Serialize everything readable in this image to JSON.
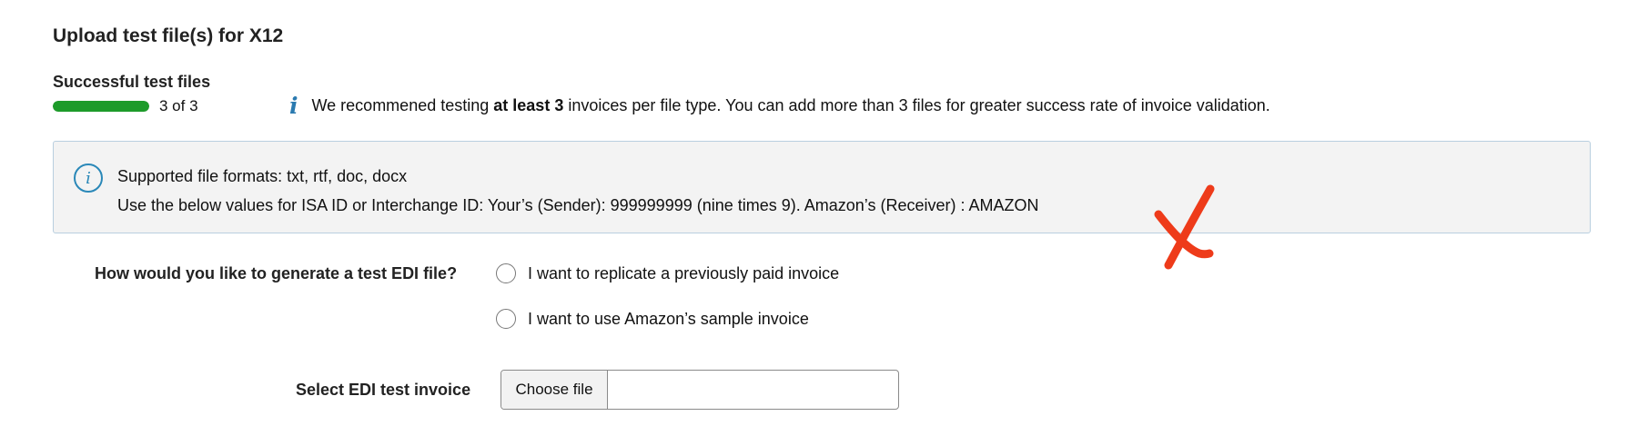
{
  "title": "Upload test file(s) for X12",
  "progress": {
    "label": "Successful test files",
    "count_text": "3 of 3",
    "completed": 3,
    "total": 3,
    "fill_fraction": 1.0,
    "color": "#1d9b2a"
  },
  "tip": {
    "icon": "info-italic-icon",
    "text_before": "We recommened testing",
    "emphasis": "at least 3",
    "text_after": "invoices per file type. You can add more than 3 files for greater success rate of invoice validation."
  },
  "info_box": {
    "icon": "info-circle-icon",
    "line1": "Supported file formats: txt, rtf, doc, docx",
    "line2": "Use the below values for ISA ID or Interchange ID: Your’s (Sender): 999999999 (nine times 9). Amazon’s (Receiver) : AMAZON"
  },
  "annotation": {
    "icon": "red-x-mark",
    "color": "#ee3b1a"
  },
  "generate": {
    "question": "How would you like to generate a test EDI file?",
    "options": [
      {
        "label": "I want to replicate a previously paid invoice",
        "selected": false
      },
      {
        "label": "I want to use Amazon’s sample invoice",
        "selected": false
      }
    ]
  },
  "select_invoice": {
    "label": "Select EDI test invoice",
    "button_label": "Choose file",
    "file_name": ""
  }
}
